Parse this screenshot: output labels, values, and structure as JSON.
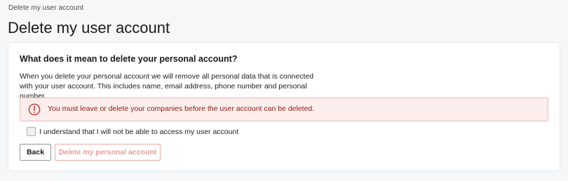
{
  "breadcrumb": {
    "text": "Delete my user account"
  },
  "page": {
    "title": "Delete my user account"
  },
  "card": {
    "heading": "What does it mean to delete your personal account?",
    "description": "When you delete your personal account we will remove all personal data that is connected with your user account. This includes name, email address, phone number and personal number."
  },
  "alert": {
    "icon": "exclamation-circle-icon",
    "message": "You must leave or delete your companies before the user account can be deleted.",
    "color": "#c0392b"
  },
  "confirm": {
    "checked": false,
    "label": "I understand that I will not be able to access my user account"
  },
  "actions": {
    "back_label": "Back",
    "delete_label": "Delete my personal account",
    "delete_disabled": true
  }
}
